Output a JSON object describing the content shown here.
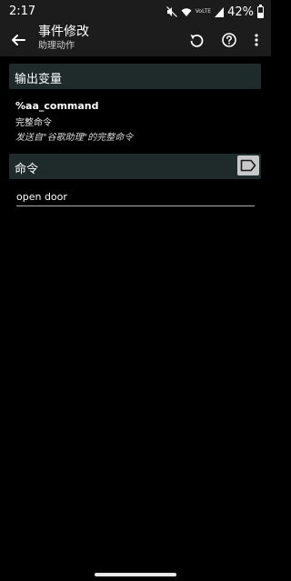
{
  "status": {
    "time": "2:17",
    "battery": "42%",
    "battery_level": 0.42,
    "network_label": "VoLTE"
  },
  "app_bar": {
    "title": "事件修改",
    "subtitle": "助理动作"
  },
  "output_vars": {
    "header": "输出变量",
    "var_name": "%aa_command",
    "var_label": "完整命令",
    "var_description": "发送自\"谷歌助理\"的完整命令"
  },
  "command": {
    "header": "命令",
    "value": "open door"
  },
  "icons": {
    "back": "arrow-left-icon",
    "undo": "undo-icon",
    "help": "help-circle-icon",
    "more": "more-vert-icon",
    "tag": "tag-icon"
  },
  "colors": {
    "background": "#000000",
    "bar": "#1c1c1c",
    "section_header": "#1f2a2a",
    "tag_button": "#c8c8c8"
  }
}
